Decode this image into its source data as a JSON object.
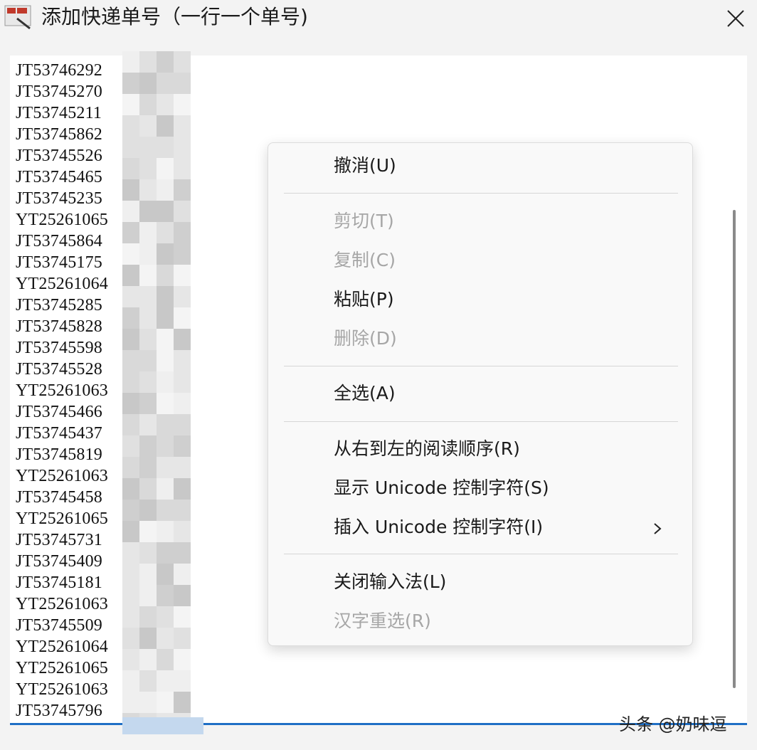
{
  "window": {
    "title": "添加快递单号（一行一个单号)",
    "close_label": "×"
  },
  "textarea": {
    "lines": [
      "JT53746292",
      "JT53745270",
      "JT53745211",
      "JT53745862",
      "JT53745526",
      "JT53745465",
      "JT53745235",
      "YT25261065",
      "JT53745864",
      "JT53745175",
      "YT25261064",
      "JT53745285",
      "JT53745828",
      "JT53745598",
      "JT53745528",
      "YT25261063",
      "JT53745466",
      "JT53745437",
      "JT53745819",
      "YT25261063",
      "JT53745458",
      "YT25261065",
      "JT53745731",
      "JT53745409",
      "JT53745181",
      "YT25261063",
      "JT53745509",
      "YT25261064",
      "YT25261065",
      "YT25261063",
      "JT53745796"
    ]
  },
  "context_menu": {
    "items": [
      {
        "label": "撤消(U)",
        "enabled": true
      },
      {
        "label": "剪切(T)",
        "enabled": false
      },
      {
        "label": "复制(C)",
        "enabled": false
      },
      {
        "label": "粘贴(P)",
        "enabled": true
      },
      {
        "label": "删除(D)",
        "enabled": false
      },
      {
        "label": "全选(A)",
        "enabled": true
      },
      {
        "label": "从右到左的阅读顺序(R)",
        "enabled": true
      },
      {
        "label": "显示 Unicode 控制字符(S)",
        "enabled": true
      },
      {
        "label": "插入 Unicode 控制字符(I)",
        "enabled": true,
        "submenu_icon": "chevron-right-icon"
      },
      {
        "label": "关闭输入法(L)",
        "enabled": true
      },
      {
        "label": "汉字重选(R)",
        "enabled": false
      }
    ]
  },
  "watermark": "头条 @奶味逗",
  "colors": {
    "focus_underline": "#1f6fc5",
    "disabled_text": "#a6a6a6",
    "selection": "#c4d8ee"
  }
}
